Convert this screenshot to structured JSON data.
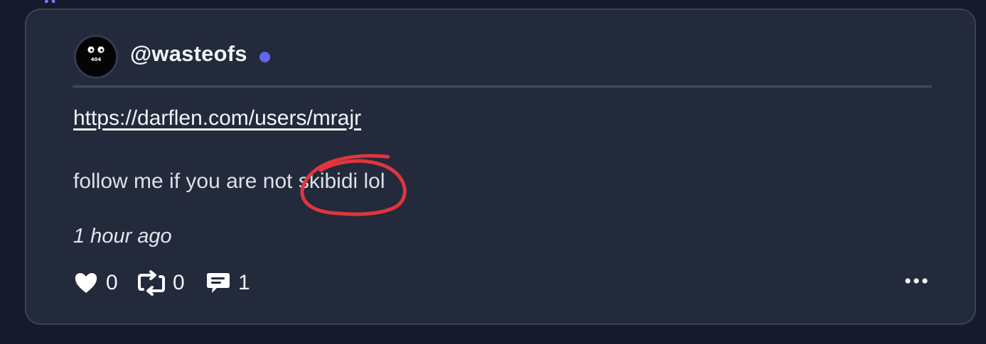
{
  "colors": {
    "page_background": "#161b2b",
    "card_background": "#232a3b",
    "card_border": "#3b4356",
    "online_indicator": "#6366f1",
    "annotation": "#e0353f",
    "text_primary": "#f2f3f6"
  },
  "top_fragment": {
    "text": "g"
  },
  "post": {
    "author": {
      "username": "@wasteofs",
      "avatar_icon": "avatar-404-icon",
      "avatar_text": "404",
      "online": true
    },
    "link": "https://darflen.com/users/mrajr",
    "text": "follow me if you are not skibidi lol",
    "timestamp": "1 hour ago",
    "actions": {
      "likes": {
        "icon": "heart-icon",
        "count": "0"
      },
      "reposts": {
        "icon": "repost-icon",
        "count": "0"
      },
      "comments": {
        "icon": "comment-icon",
        "count": "1"
      },
      "more": {
        "icon": "more-icon"
      }
    },
    "annotation": {
      "icon": "red-circle-annotation"
    }
  }
}
